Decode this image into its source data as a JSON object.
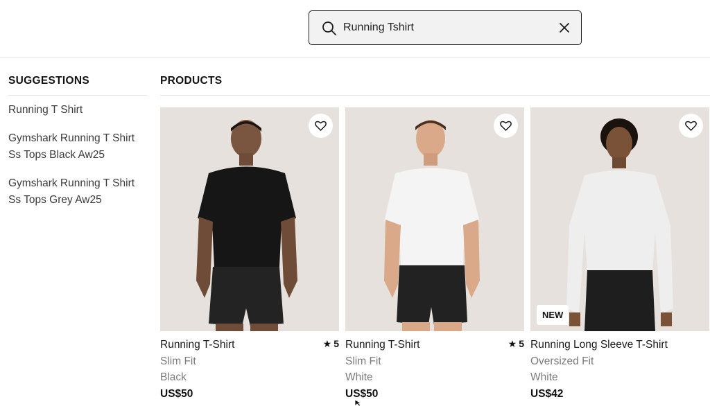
{
  "search": {
    "value": "Running Tshirt",
    "placeholder": ""
  },
  "suggestions": {
    "title": "SUGGESTIONS",
    "items": [
      {
        "label": "Running T Shirt"
      },
      {
        "label": "Gymshark Running T Shirt Ss Tops Black Aw25"
      },
      {
        "label": "Gymshark Running T Shirt Ss Tops Grey Aw25"
      }
    ]
  },
  "products": {
    "title": "PRODUCTS",
    "items": [
      {
        "name": "Running T-Shirt",
        "fit": "Slim Fit",
        "color": "Black",
        "price": "US$50",
        "rating": "5",
        "badge": "",
        "shirt_color": "#161616"
      },
      {
        "name": "Running T-Shirt",
        "fit": "Slim Fit",
        "color": "White",
        "price": "US$50",
        "rating": "5",
        "badge": "",
        "shirt_color": "#f4f4f4"
      },
      {
        "name": "Running Long Sleeve T-Shirt",
        "fit": "Oversized Fit",
        "color": "White",
        "price": "US$42",
        "rating": "",
        "badge": "NEW",
        "shirt_color": "#eeeeee"
      }
    ]
  },
  "colors": {
    "photo_bg": "#e6e1dc",
    "border": "#e3e3e3",
    "text_muted": "#7a7a7a"
  }
}
